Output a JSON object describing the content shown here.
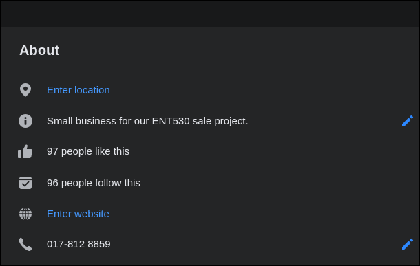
{
  "about": {
    "title": "About",
    "location": {
      "label": "Enter location",
      "icon": "location-pin-icon"
    },
    "description": {
      "text": "Small business for our ENT530 sale project.",
      "icon": "info-icon"
    },
    "likes": {
      "text": "97 people like this",
      "icon": "thumbs-up-icon"
    },
    "follows": {
      "text": "96 people follow this",
      "icon": "follow-check-icon"
    },
    "website": {
      "label": "Enter website",
      "icon": "globe-icon"
    },
    "phone": {
      "text": "017-812 8859",
      "icon": "phone-icon"
    }
  },
  "colors": {
    "background": "#242526",
    "top_strip": "#18191a",
    "text": "#e4e6eb",
    "icon": "#b0b3b8",
    "link": "#4599ff",
    "edit_icon": "#2d88ff"
  }
}
